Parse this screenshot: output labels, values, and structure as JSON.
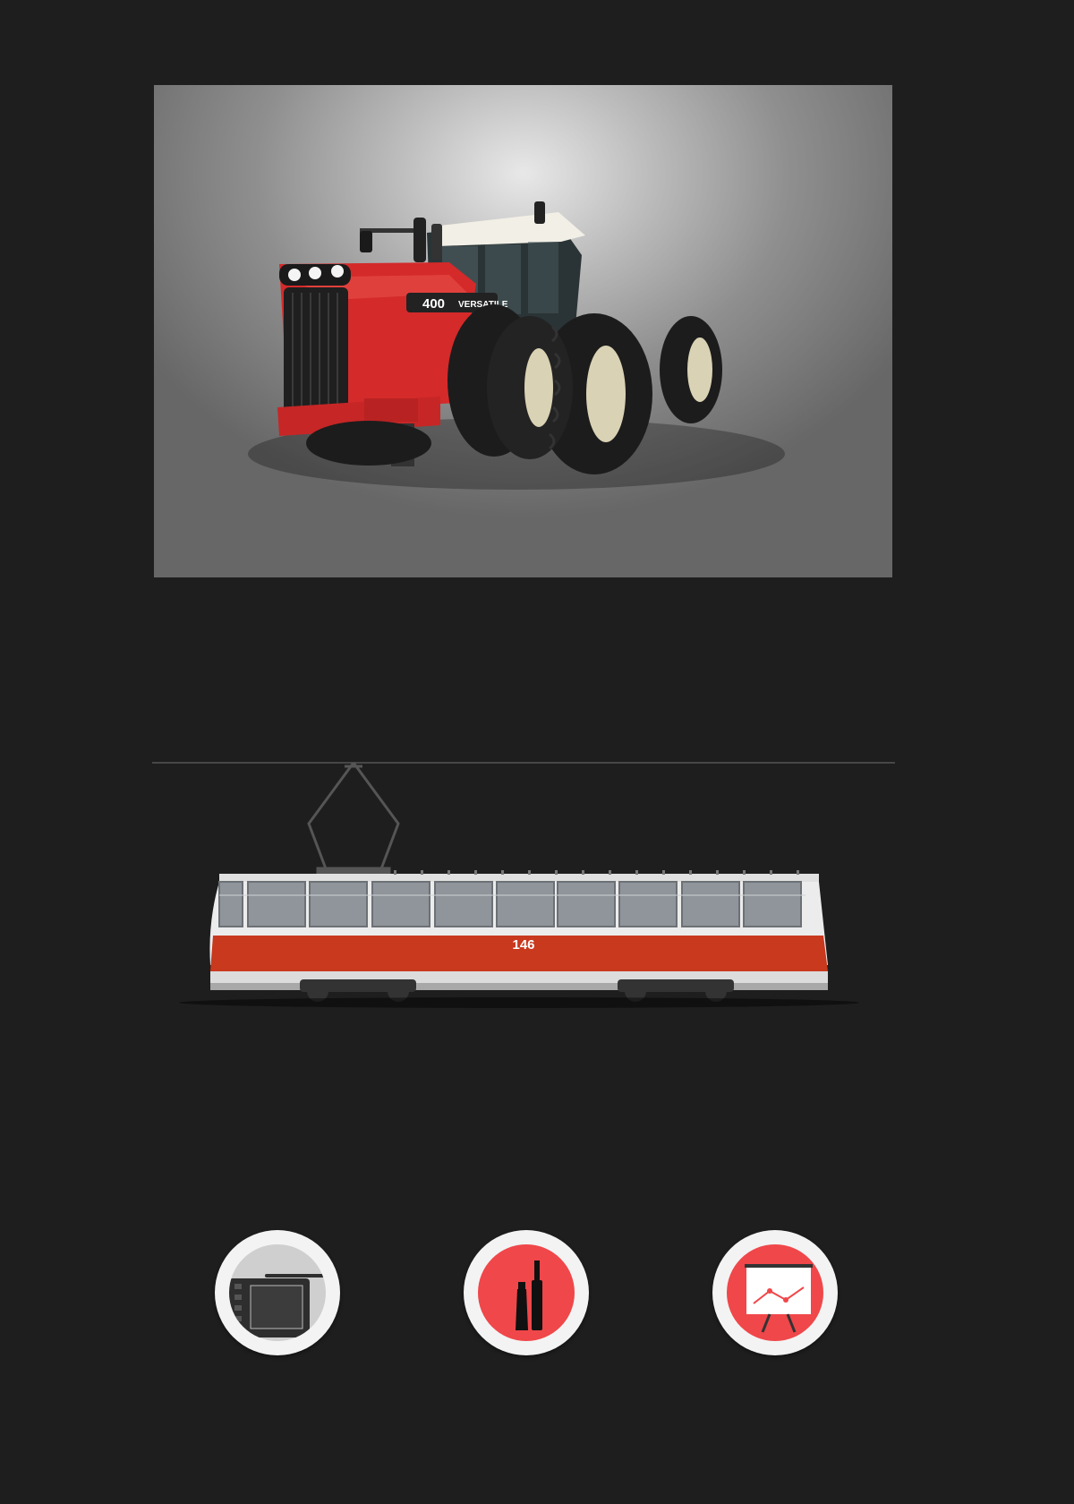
{
  "tractor": {
    "model_number": "400",
    "brand": "VERSATILE",
    "colors": {
      "body": "#d42a2a",
      "tyre": "#1c1c1c",
      "rim": "#d9d2b4",
      "cab": "#2a3436",
      "roof": "#f2efe6"
    }
  },
  "tram": {
    "number": "146",
    "colors": {
      "stripe": "#c8391e",
      "body": "#ececec",
      "skirt": "#a8a8a8",
      "window": "#8f959a",
      "pantograph": "#555555"
    }
  },
  "icons": [
    {
      "name": "drawing-tablet-icon",
      "background": "#cfcfcf"
    },
    {
      "name": "mascara-lipstick-icon",
      "background": "#f0474a"
    },
    {
      "name": "presentation-board-icon",
      "background": "#f0474a"
    }
  ],
  "colors": {
    "page_background": "#1e1e1e",
    "accent": "#f0474a"
  }
}
